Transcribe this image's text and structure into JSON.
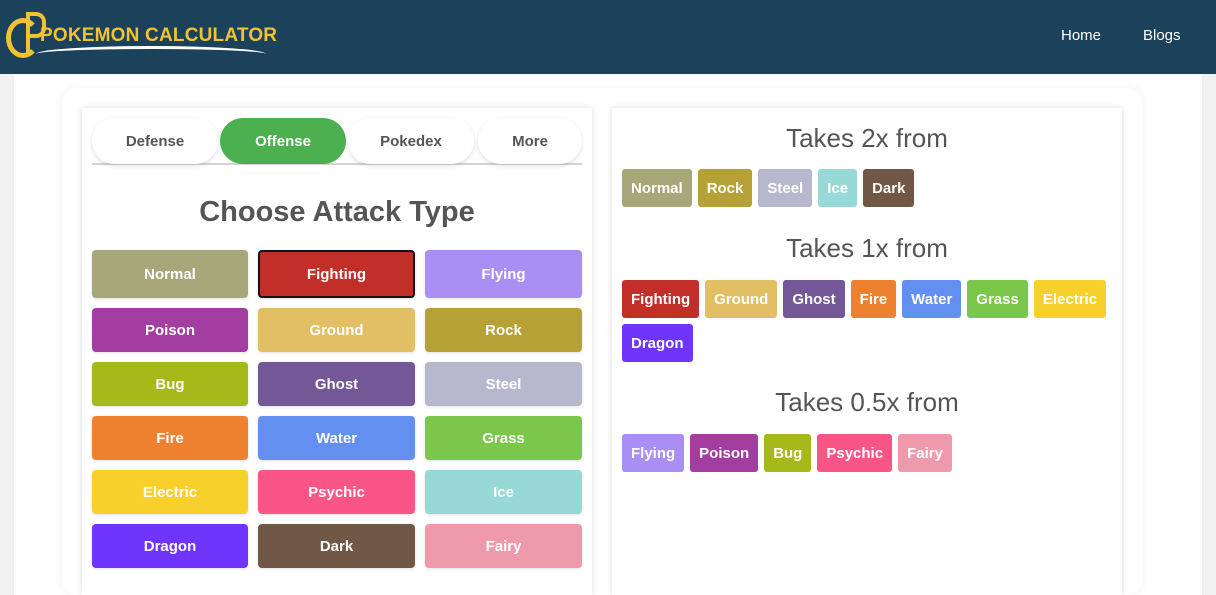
{
  "header": {
    "logo_text": "POKEMON CALCULATOR",
    "nav": [
      {
        "label": "Home"
      },
      {
        "label": "Blogs"
      }
    ]
  },
  "tabs": [
    {
      "label": "Defense",
      "active": false
    },
    {
      "label": "Offense",
      "active": true
    },
    {
      "label": "Pokedex",
      "active": false
    },
    {
      "label": "More",
      "active": false
    }
  ],
  "heading": "Choose Attack Type",
  "types": [
    {
      "label": "Normal",
      "color": "#a8a77a",
      "selected": false
    },
    {
      "label": "Fighting",
      "color": "#c22e28",
      "selected": true
    },
    {
      "label": "Flying",
      "color": "#a98ff3",
      "selected": false
    },
    {
      "label": "Poison",
      "color": "#a33ea1",
      "selected": false
    },
    {
      "label": "Ground",
      "color": "#e2bf65",
      "selected": false
    },
    {
      "label": "Rock",
      "color": "#b6a136",
      "selected": false
    },
    {
      "label": "Bug",
      "color": "#a6b91a",
      "selected": false
    },
    {
      "label": "Ghost",
      "color": "#735797",
      "selected": false
    },
    {
      "label": "Steel",
      "color": "#b7b7ce",
      "selected": false
    },
    {
      "label": "Fire",
      "color": "#ee8130",
      "selected": false
    },
    {
      "label": "Water",
      "color": "#6390f0",
      "selected": false
    },
    {
      "label": "Grass",
      "color": "#7ac74c",
      "selected": false
    },
    {
      "label": "Electric",
      "color": "#f7d02c",
      "selected": false
    },
    {
      "label": "Psychic",
      "color": "#f95587",
      "selected": false
    },
    {
      "label": "Ice",
      "color": "#96d9d6",
      "selected": false
    },
    {
      "label": "Dragon",
      "color": "#6f35fc",
      "selected": false
    },
    {
      "label": "Dark",
      "color": "#705746",
      "selected": false
    },
    {
      "label": "Fairy",
      "color": "#ee99ac",
      "selected": false
    }
  ],
  "results": [
    {
      "title": "Takes 2x from",
      "types": [
        {
          "label": "Normal",
          "color": "#a8a77a"
        },
        {
          "label": "Rock",
          "color": "#b6a136"
        },
        {
          "label": "Steel",
          "color": "#b7b7ce"
        },
        {
          "label": "Ice",
          "color": "#96d9d6"
        },
        {
          "label": "Dark",
          "color": "#705746"
        }
      ]
    },
    {
      "title": "Takes 1x from",
      "types": [
        {
          "label": "Fighting",
          "color": "#c22e28"
        },
        {
          "label": "Ground",
          "color": "#e2bf65"
        },
        {
          "label": "Ghost",
          "color": "#735797"
        },
        {
          "label": "Fire",
          "color": "#ee8130"
        },
        {
          "label": "Water",
          "color": "#6390f0"
        },
        {
          "label": "Grass",
          "color": "#7ac74c"
        },
        {
          "label": "Electric",
          "color": "#f7d02c"
        },
        {
          "label": "Dragon",
          "color": "#6f35fc"
        }
      ]
    },
    {
      "title": "Takes 0.5x from",
      "types": [
        {
          "label": "Flying",
          "color": "#a98ff3"
        },
        {
          "label": "Poison",
          "color": "#a33ea1"
        },
        {
          "label": "Bug",
          "color": "#a6b91a"
        },
        {
          "label": "Psychic",
          "color": "#f95587"
        },
        {
          "label": "Fairy",
          "color": "#ee99ac"
        }
      ]
    }
  ]
}
